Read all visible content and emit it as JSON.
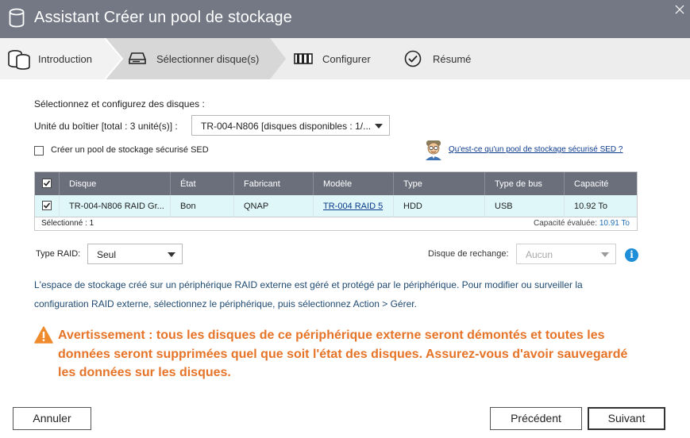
{
  "window": {
    "title": "Assistant Créer un pool de stockage"
  },
  "steps": [
    {
      "label": "Introduction",
      "icon": "database-icon",
      "active": false
    },
    {
      "label": "Sélectionner disque(s)",
      "icon": "disk-drive-icon",
      "active": true
    },
    {
      "label": "Configurer",
      "icon": "raid-config-icon",
      "active": false
    },
    {
      "label": "Résumé",
      "icon": "checkmark-circle-icon",
      "active": false
    }
  ],
  "form": {
    "section_title": "Sélectionnez et configurez des disques :",
    "enclosure_label": "Unité du boîtier [total : 3 unité(s)] :",
    "enclosure_value": "TR-004-N806 [disques disponibles : 1/...",
    "sed_checkbox_label": "Créer un pool de stockage sécurisé SED",
    "sed_checked": false,
    "sed_link": "Qu'est-ce qu'un pool de stockage sécurisé SED ?"
  },
  "table": {
    "columns": [
      "Disque",
      "État",
      "Fabricant",
      "Modèle",
      "Type",
      "Type de bus",
      "Capacité"
    ],
    "header_checked": true,
    "rows": [
      {
        "checked": true,
        "disk": "TR-004-N806 RAID Gr...",
        "state": "Bon",
        "manufacturer": "QNAP",
        "model": "TR-004 RAID 5",
        "type": "HDD",
        "bus_type": "USB",
        "capacity": "10.92 To"
      }
    ],
    "selected_text": "Sélectionné : 1",
    "estimated_capacity_label": "Capacité évaluée:",
    "estimated_capacity_value": "10.91 To"
  },
  "raid": {
    "type_label": "Type RAID:",
    "type_value": "Seul",
    "spare_label": "Disque de rechange:",
    "spare_value": "Aucun",
    "info_glyph": "i"
  },
  "info_text": "L'espace de stockage créé sur un périphérique RAID externe est géré et protégé par le périphérique. Pour modifier ou surveiller la configuration RAID externe, sélectionnez le périphérique, puis sélectionnez Action > Gérer.",
  "warning_text": "Avertissement : tous les disques de ce périphérique externe seront démontés et toutes les données seront supprimées quel que soit l'état des disques. Assurez-vous d'avoir sauvegardé les données sur les disques.",
  "buttons": {
    "cancel": "Annuler",
    "previous": "Précédent",
    "next": "Suivant"
  },
  "colors": {
    "titlebar": "#737884",
    "table_header": "#6a6f7b",
    "selected_row": "#dff7f8",
    "warning": "#e67428",
    "link": "#0b3a8c",
    "info_text": "#1f4a72"
  }
}
